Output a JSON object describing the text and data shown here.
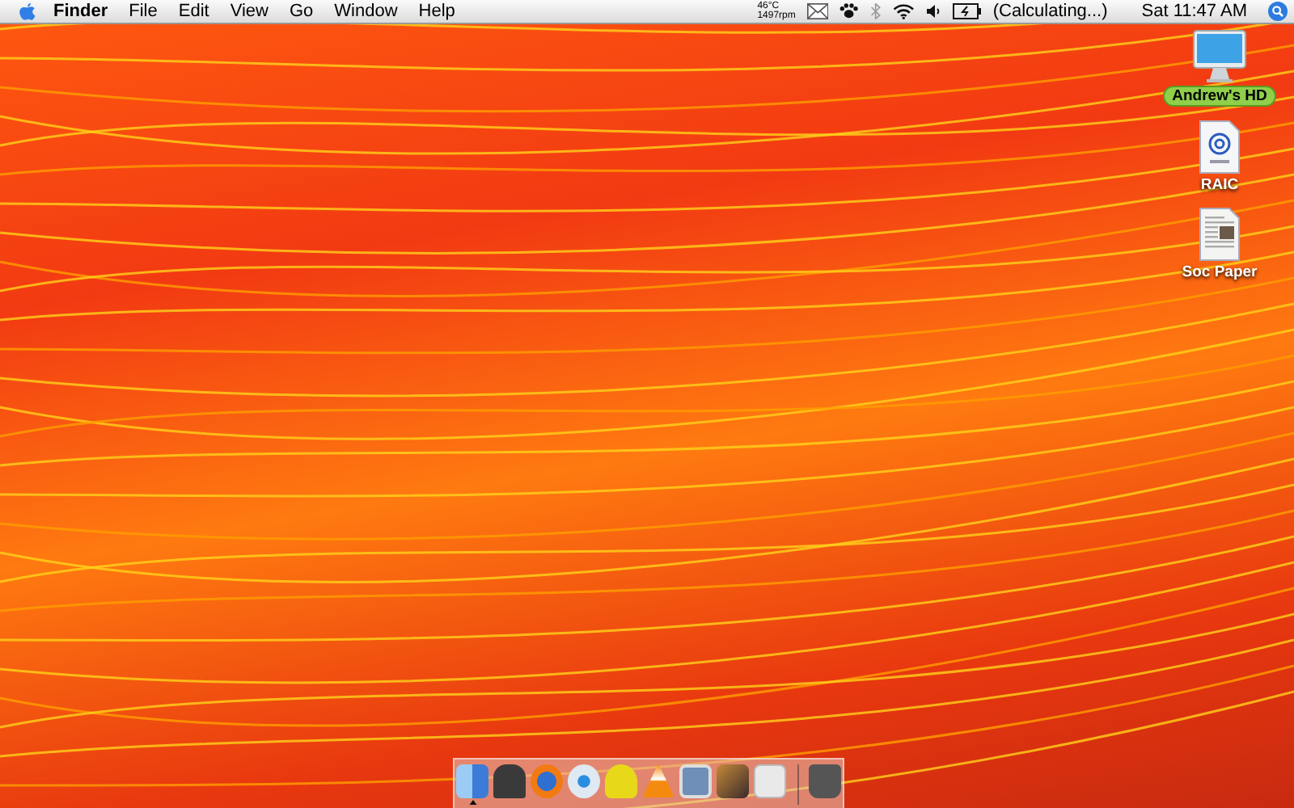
{
  "menu_bar": {
    "app_name": "Finder",
    "menus": [
      "File",
      "Edit",
      "View",
      "Go",
      "Window",
      "Help"
    ],
    "temperature": "46°C",
    "fan_speed": "1497rpm",
    "battery_status": "(Calculating...)",
    "clock": "Sat 11:47 AM"
  },
  "desktop_icons": [
    {
      "kind": "drive",
      "label": "Andrew's HD",
      "selected": true
    },
    {
      "kind": "weblink",
      "label": "RAIC",
      "selected": false
    },
    {
      "kind": "document",
      "label": "Soc Paper",
      "selected": false
    }
  ],
  "dock": [
    {
      "running": true
    },
    {
      "running": false
    },
    {
      "running": false
    },
    {
      "running": false
    },
    {
      "running": false
    },
    {
      "running": false
    },
    {
      "running": false
    },
    {
      "running": false
    },
    {
      "running": false
    },
    {
      "running": false
    }
  ]
}
